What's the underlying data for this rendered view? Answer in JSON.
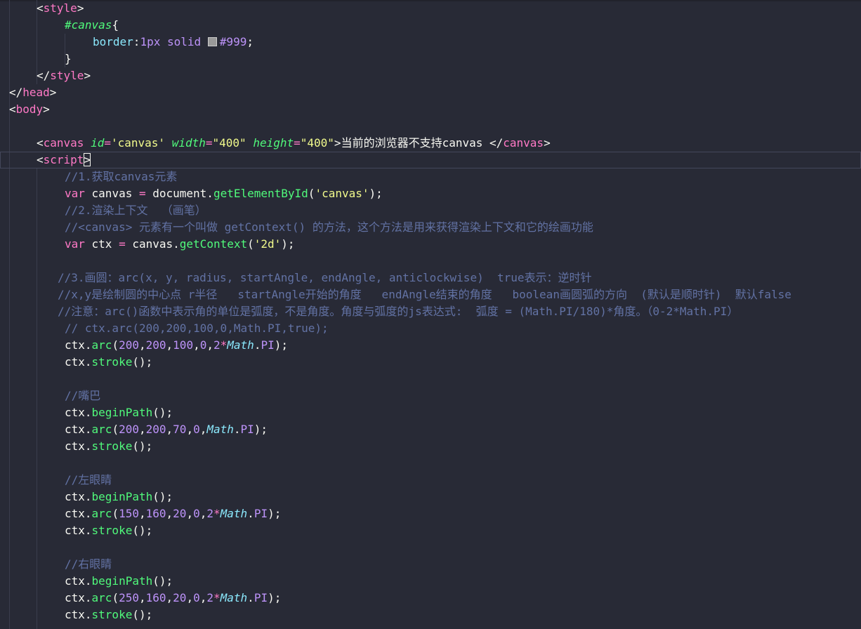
{
  "editor": {
    "swatch_color": "#999999",
    "lines": [
      {
        "indent": 52,
        "tokens": [
          [
            "t-punct",
            "<"
          ],
          [
            "t-tag",
            "style"
          ],
          [
            "t-punct",
            ">"
          ]
        ]
      },
      {
        "indent": 92,
        "tokens": [
          [
            "t-selector",
            "#canvas"
          ],
          [
            "t-punct",
            "{"
          ]
        ]
      },
      {
        "indent": 132,
        "tokens": [
          [
            "t-cssprop",
            "border"
          ],
          [
            "t-punct",
            ":"
          ],
          [
            "t-cssval",
            "1px"
          ],
          [
            "t-plain",
            " "
          ],
          [
            "t-cssval",
            "solid"
          ],
          [
            "t-plain",
            " "
          ],
          [
            "swatch",
            ""
          ],
          [
            "t-cssval",
            "#999"
          ],
          [
            "t-punct",
            ";"
          ]
        ]
      },
      {
        "indent": 92,
        "tokens": [
          [
            "t-punct",
            "}"
          ]
        ]
      },
      {
        "indent": 52,
        "tokens": [
          [
            "t-punct",
            "</"
          ],
          [
            "t-tag",
            "style"
          ],
          [
            "t-punct",
            ">"
          ]
        ]
      },
      {
        "indent": 13,
        "tokens": [
          [
            "t-punct",
            "</"
          ],
          [
            "t-tag",
            "head"
          ],
          [
            "t-punct",
            ">"
          ]
        ]
      },
      {
        "indent": 13,
        "tokens": [
          [
            "t-punct",
            "<"
          ],
          [
            "t-tag",
            "body"
          ],
          [
            "t-punct",
            ">"
          ]
        ]
      },
      {
        "indent": 13,
        "tokens": []
      },
      {
        "indent": 52,
        "tokens": [
          [
            "t-punct",
            "<"
          ],
          [
            "t-tag",
            "canvas"
          ],
          [
            "t-plain",
            " "
          ],
          [
            "t-attr",
            "id"
          ],
          [
            "t-op",
            "="
          ],
          [
            "t-string",
            "'canvas'"
          ],
          [
            "t-plain",
            " "
          ],
          [
            "t-attr",
            "width"
          ],
          [
            "t-op",
            "="
          ],
          [
            "t-string",
            "\"400\""
          ],
          [
            "t-plain",
            " "
          ],
          [
            "t-attr",
            "height"
          ],
          [
            "t-op",
            "="
          ],
          [
            "t-string",
            "\"400\""
          ],
          [
            "t-punct",
            ">"
          ],
          [
            "t-text",
            "当前的浏览器不支持canvas "
          ],
          [
            "t-punct",
            "</"
          ],
          [
            "t-tag",
            "canvas"
          ],
          [
            "t-punct",
            ">"
          ]
        ]
      },
      {
        "indent": 52,
        "current": true,
        "tokens": [
          [
            "t-punct",
            "<"
          ],
          [
            "t-tag",
            "script"
          ],
          [
            "cursor",
            ">"
          ]
        ]
      },
      {
        "indent": 92,
        "tokens": [
          [
            "t-comment",
            "//1.获取canvas元素"
          ]
        ]
      },
      {
        "indent": 92,
        "tokens": [
          [
            "t-keyword",
            "var"
          ],
          [
            "t-plain",
            " canvas "
          ],
          [
            "t-op",
            "="
          ],
          [
            "t-plain",
            " document."
          ],
          [
            "t-func",
            "getElementById"
          ],
          [
            "t-punct",
            "("
          ],
          [
            "t-string",
            "'canvas'"
          ],
          [
            "t-punct",
            ");"
          ]
        ]
      },
      {
        "indent": 92,
        "tokens": [
          [
            "t-comment",
            "//2.渲染上下文  （画笔）"
          ]
        ]
      },
      {
        "indent": 92,
        "tokens": [
          [
            "t-comment",
            "//<canvas> 元素有一个叫做 getContext() 的方法，这个方法是用来获得渲染上下文和它的绘画功能"
          ]
        ]
      },
      {
        "indent": 92,
        "tokens": [
          [
            "t-keyword",
            "var"
          ],
          [
            "t-plain",
            " ctx "
          ],
          [
            "t-op",
            "="
          ],
          [
            "t-plain",
            " canvas."
          ],
          [
            "t-func",
            "getContext"
          ],
          [
            "t-punct",
            "("
          ],
          [
            "t-string",
            "'2d'"
          ],
          [
            "t-punct",
            ");"
          ]
        ]
      },
      {
        "indent": 13,
        "tokens": []
      },
      {
        "indent": 82,
        "tokens": [
          [
            "t-comment",
            "//3.画圆：arc(x, y, radius, startAngle, endAngle, anticlockwise)  true表示：逆时针"
          ]
        ]
      },
      {
        "indent": 82,
        "tokens": [
          [
            "t-comment",
            "//x,y是绘制圆的中心点 r半径   startAngle开始的角度   endAngle结束的角度   boolean画圆弧的方向  (默认是顺时针)  默认false"
          ]
        ]
      },
      {
        "indent": 82,
        "tokens": [
          [
            "t-comment",
            "//注意：arc()函数中表示角的单位是弧度，不是角度。角度与弧度的js表达式:  弧度 = (Math.PI/180)*角度。（0-2*Math.PI）"
          ]
        ]
      },
      {
        "indent": 92,
        "tokens": [
          [
            "t-comment",
            "// ctx.arc(200,200,100,0,Math.PI,true);"
          ]
        ]
      },
      {
        "indent": 92,
        "tokens": [
          [
            "t-plain",
            "ctx."
          ],
          [
            "t-func",
            "arc"
          ],
          [
            "t-punct",
            "("
          ],
          [
            "t-number",
            "200"
          ],
          [
            "t-punct",
            ","
          ],
          [
            "t-number",
            "200"
          ],
          [
            "t-punct",
            ","
          ],
          [
            "t-number",
            "100"
          ],
          [
            "t-punct",
            ","
          ],
          [
            "t-number",
            "0"
          ],
          [
            "t-punct",
            ","
          ],
          [
            "t-number",
            "2"
          ],
          [
            "t-op",
            "*"
          ],
          [
            "t-class",
            "Math"
          ],
          [
            "t-punct",
            "."
          ],
          [
            "t-prop",
            "PI"
          ],
          [
            "t-punct",
            ");"
          ]
        ]
      },
      {
        "indent": 92,
        "tokens": [
          [
            "t-plain",
            "ctx."
          ],
          [
            "t-func",
            "stroke"
          ],
          [
            "t-punct",
            "();"
          ]
        ]
      },
      {
        "indent": 13,
        "tokens": []
      },
      {
        "indent": 92,
        "tokens": [
          [
            "t-comment",
            "//嘴巴"
          ]
        ]
      },
      {
        "indent": 92,
        "tokens": [
          [
            "t-plain",
            "ctx."
          ],
          [
            "t-func",
            "beginPath"
          ],
          [
            "t-punct",
            "();"
          ]
        ]
      },
      {
        "indent": 92,
        "tokens": [
          [
            "t-plain",
            "ctx."
          ],
          [
            "t-func",
            "arc"
          ],
          [
            "t-punct",
            "("
          ],
          [
            "t-number",
            "200"
          ],
          [
            "t-punct",
            ","
          ],
          [
            "t-number",
            "200"
          ],
          [
            "t-punct",
            ","
          ],
          [
            "t-number",
            "70"
          ],
          [
            "t-punct",
            ","
          ],
          [
            "t-number",
            "0"
          ],
          [
            "t-punct",
            ","
          ],
          [
            "t-class",
            "Math"
          ],
          [
            "t-punct",
            "."
          ],
          [
            "t-prop",
            "PI"
          ],
          [
            "t-punct",
            ");"
          ]
        ]
      },
      {
        "indent": 92,
        "tokens": [
          [
            "t-plain",
            "ctx."
          ],
          [
            "t-func",
            "stroke"
          ],
          [
            "t-punct",
            "();"
          ]
        ]
      },
      {
        "indent": 13,
        "tokens": []
      },
      {
        "indent": 92,
        "tokens": [
          [
            "t-comment",
            "//左眼睛"
          ]
        ]
      },
      {
        "indent": 92,
        "tokens": [
          [
            "t-plain",
            "ctx."
          ],
          [
            "t-func",
            "beginPath"
          ],
          [
            "t-punct",
            "();"
          ]
        ]
      },
      {
        "indent": 92,
        "tokens": [
          [
            "t-plain",
            "ctx."
          ],
          [
            "t-func",
            "arc"
          ],
          [
            "t-punct",
            "("
          ],
          [
            "t-number",
            "150"
          ],
          [
            "t-punct",
            ","
          ],
          [
            "t-number",
            "160"
          ],
          [
            "t-punct",
            ","
          ],
          [
            "t-number",
            "20"
          ],
          [
            "t-punct",
            ","
          ],
          [
            "t-number",
            "0"
          ],
          [
            "t-punct",
            ","
          ],
          [
            "t-number",
            "2"
          ],
          [
            "t-op",
            "*"
          ],
          [
            "t-class",
            "Math"
          ],
          [
            "t-punct",
            "."
          ],
          [
            "t-prop",
            "PI"
          ],
          [
            "t-punct",
            ");"
          ]
        ]
      },
      {
        "indent": 92,
        "tokens": [
          [
            "t-plain",
            "ctx."
          ],
          [
            "t-func",
            "stroke"
          ],
          [
            "t-punct",
            "();"
          ]
        ]
      },
      {
        "indent": 13,
        "tokens": []
      },
      {
        "indent": 92,
        "tokens": [
          [
            "t-comment",
            "//右眼睛"
          ]
        ]
      },
      {
        "indent": 92,
        "tokens": [
          [
            "t-plain",
            "ctx."
          ],
          [
            "t-func",
            "beginPath"
          ],
          [
            "t-punct",
            "();"
          ]
        ]
      },
      {
        "indent": 92,
        "tokens": [
          [
            "t-plain",
            "ctx."
          ],
          [
            "t-func",
            "arc"
          ],
          [
            "t-punct",
            "("
          ],
          [
            "t-number",
            "250"
          ],
          [
            "t-punct",
            ","
          ],
          [
            "t-number",
            "160"
          ],
          [
            "t-punct",
            ","
          ],
          [
            "t-number",
            "20"
          ],
          [
            "t-punct",
            ","
          ],
          [
            "t-number",
            "0"
          ],
          [
            "t-punct",
            ","
          ],
          [
            "t-number",
            "2"
          ],
          [
            "t-op",
            "*"
          ],
          [
            "t-class",
            "Math"
          ],
          [
            "t-punct",
            "."
          ],
          [
            "t-prop",
            "PI"
          ],
          [
            "t-punct",
            ");"
          ]
        ]
      },
      {
        "indent": 92,
        "tokens": [
          [
            "t-plain",
            "ctx."
          ],
          [
            "t-func",
            "stroke"
          ],
          [
            "t-punct",
            "();"
          ]
        ]
      }
    ]
  }
}
